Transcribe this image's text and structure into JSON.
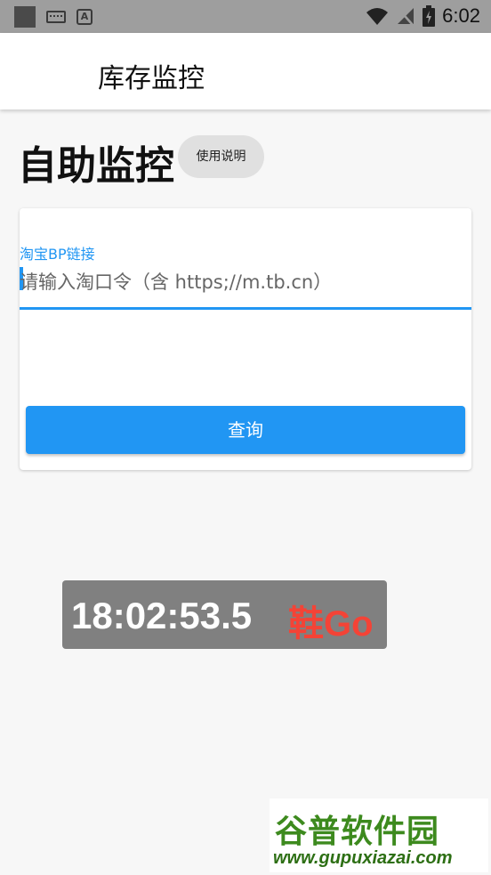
{
  "status_bar": {
    "time": "6:02",
    "icons": [
      "notification-square-icon",
      "keyboard-icon",
      "font-app-icon",
      "wifi-icon",
      "no-signal-icon",
      "battery-charging-icon"
    ]
  },
  "app_bar": {
    "title": "库存监控"
  },
  "page": {
    "heading": "自助监控",
    "help_button": "使用说明"
  },
  "form": {
    "field_label": "淘宝BP链接",
    "field_placeholder": "请输入淘口令（含 https;//m.tb.cn）",
    "query_button": "查询"
  },
  "overlay": {
    "time": "18:02:53.5",
    "brand": "鞋Go"
  },
  "watermark": {
    "title": "谷普软件园",
    "url": "www.gupuxiazai.com"
  },
  "colors": {
    "accent": "#2196f3",
    "brand_red": "#f44336",
    "watermark_green": "#3d8a1e"
  }
}
